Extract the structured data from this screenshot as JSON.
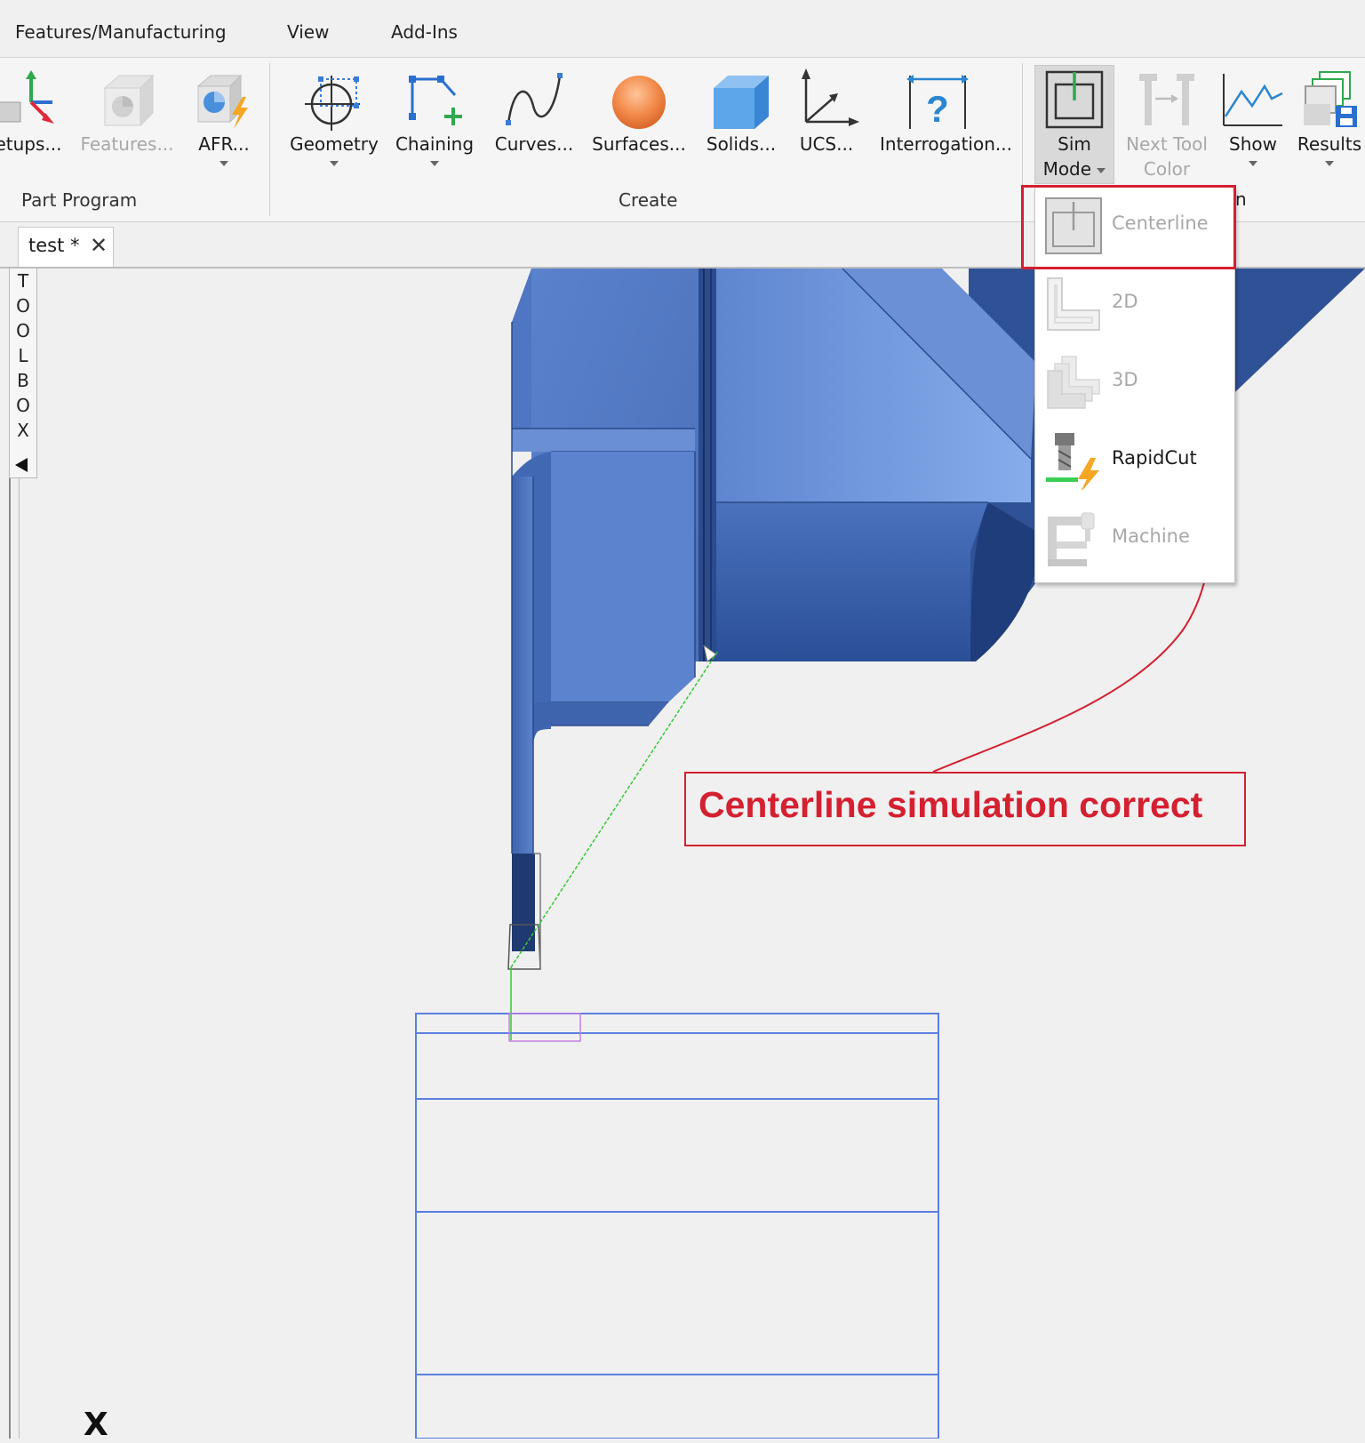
{
  "menubar": {
    "items": [
      "Features/Manufacturing",
      "View",
      "Add-Ins"
    ]
  },
  "ribbon": {
    "groups": [
      {
        "label": "Part Program"
      },
      {
        "label": "Create"
      }
    ],
    "buttons": {
      "setups": {
        "label": "etups...",
        "icon": "setups-axis-icon"
      },
      "features": {
        "label": "Features...",
        "icon": "features-icon",
        "disabled": true
      },
      "afr": {
        "label": "AFR...",
        "icon": "afr-icon"
      },
      "geometry": {
        "label": "Geometry",
        "icon": "geometry-icon"
      },
      "chaining": {
        "label": "Chaining",
        "icon": "chaining-icon"
      },
      "curves": {
        "label": "Curves...",
        "icon": "curves-icon"
      },
      "surfaces": {
        "label": "Surfaces...",
        "icon": "surfaces-sphere-icon"
      },
      "solids": {
        "label": "Solids...",
        "icon": "solids-cube-icon"
      },
      "ucs": {
        "label": "UCS...",
        "icon": "ucs-axes-icon"
      },
      "interrogation": {
        "label": "Interrogation...",
        "icon": "interrogation-icon"
      },
      "sim_mode": {
        "label_line1": "Sim",
        "label_line2": "Mode",
        "icon": "sim-mode-icon"
      },
      "next_tool_color": {
        "label_line1": "Next Tool",
        "label_line2": "Color",
        "icon": "next-tool-color-icon",
        "disabled": true
      },
      "show": {
        "label": "Show",
        "icon": "show-graph-icon"
      },
      "results": {
        "label": "Results",
        "icon": "results-icon"
      }
    },
    "partial_group_label": "n"
  },
  "tabs": [
    {
      "label": "test *",
      "active": true
    }
  ],
  "toolbox": {
    "letters": [
      "T",
      "O",
      "O",
      "L",
      "B",
      "O",
      "X"
    ]
  },
  "sim_mode_menu": {
    "items": [
      {
        "label": "Centerline",
        "icon": "centerline-icon",
        "disabled": true,
        "selected": true
      },
      {
        "label": "2D",
        "icon": "2d-icon",
        "disabled": true
      },
      {
        "label": "3D",
        "icon": "3d-icon",
        "disabled": true
      },
      {
        "label": "RapidCut",
        "icon": "rapidcut-icon",
        "disabled": false
      },
      {
        "label": "Machine",
        "icon": "machine-icon",
        "disabled": true
      }
    ]
  },
  "annotation": {
    "text": "Centerline simulation correct",
    "color": "#d42030"
  },
  "viewport": {
    "axis_label": "X"
  },
  "colors": {
    "solid_blue": "#4f79c4",
    "solid_blue_dark": "#213f7a",
    "stock_outline": "#5b7fe0",
    "toolpath_green": "#36c836",
    "callout_red": "#d42030"
  }
}
